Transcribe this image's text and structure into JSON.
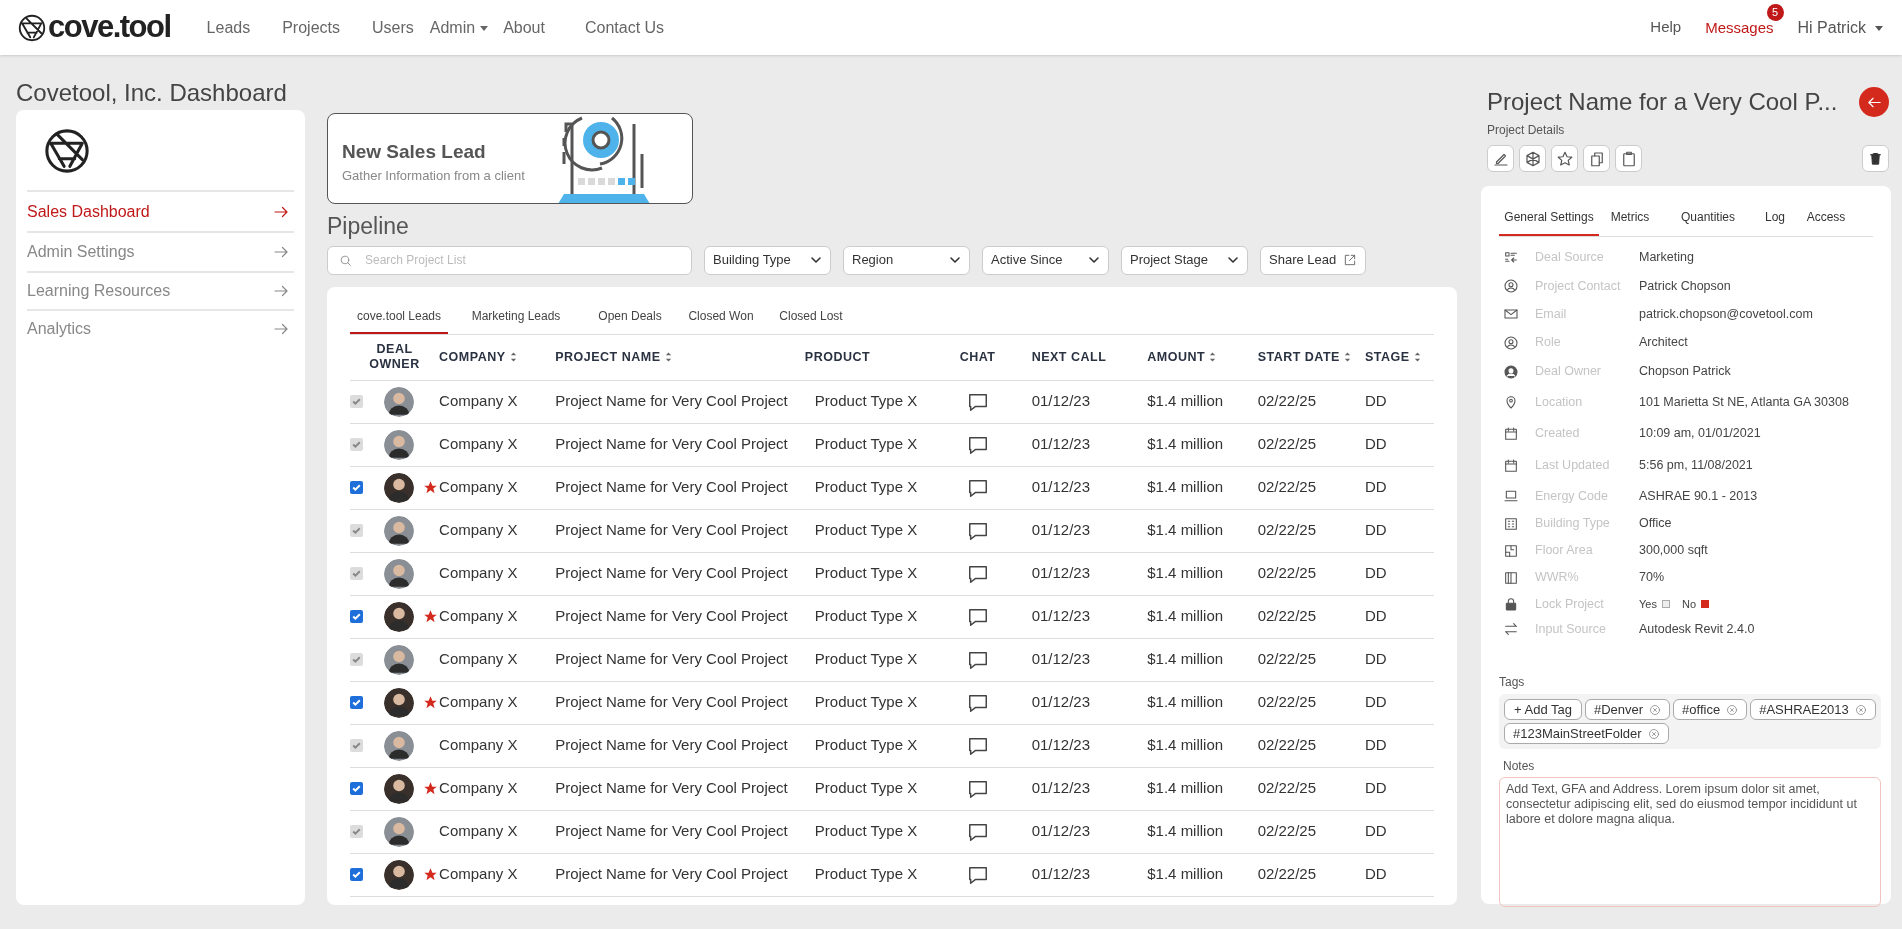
{
  "nav": {
    "logo": "cove.tool",
    "links": [
      {
        "label": "Leads",
        "dropdown": false
      },
      {
        "label": "Projects",
        "dropdown": false
      },
      {
        "label": "Users",
        "dropdown": false
      },
      {
        "label": "Admin",
        "dropdown": true
      },
      {
        "label": "About",
        "dropdown": false
      },
      {
        "label": "Contact Us",
        "dropdown": false
      }
    ],
    "right": {
      "help": "Help",
      "messages": "Messages",
      "badge": "5",
      "user": "Hi Patrick"
    }
  },
  "page_title": "Covetool, Inc. Dashboard",
  "sidebar": {
    "items": [
      {
        "label": "Sales Dashboard",
        "selected": true
      },
      {
        "label": "Admin Settings",
        "selected": false
      },
      {
        "label": "Learning Resources",
        "selected": false
      },
      {
        "label": "Analytics",
        "selected": false
      }
    ]
  },
  "new_lead": {
    "title": "New Sales Lead",
    "subtitle": "Gather Information from a client"
  },
  "pipeline": {
    "title": "Pipeline",
    "search": {
      "placeholder": "Search Project List"
    },
    "filters": [
      "Building Type",
      "Region",
      "Active Since",
      "Project Stage"
    ],
    "share": "Share Lead",
    "tabs": [
      {
        "label": "cove.tool Leads",
        "selected": true
      },
      {
        "label": "Marketing Leads",
        "selected": false
      },
      {
        "label": "Open Deals",
        "selected": false
      },
      {
        "label": "Closed Won",
        "selected": false
      },
      {
        "label": "Closed Lost",
        "selected": false
      }
    ],
    "columns": [
      {
        "label": "DEAL OWNER",
        "sortable": false
      },
      {
        "label": "COMPANY",
        "sortable": true
      },
      {
        "label": "PROJECT NAME",
        "sortable": true
      },
      {
        "label": "PRODUCT",
        "sortable": false
      },
      {
        "label": "CHAT",
        "sortable": false
      },
      {
        "label": "NEXT CALL",
        "sortable": false
      },
      {
        "label": "AMOUNT",
        "sortable": true
      },
      {
        "label": "START DATE",
        "sortable": true
      },
      {
        "label": "STAGE",
        "sortable": true
      }
    ],
    "rows": [
      {
        "checked": true,
        "disabled": true,
        "starred": false,
        "company": "Company X",
        "project": "Project Name for Very Cool Project",
        "product": "Product Type X",
        "next_call": "01/12/23",
        "amount": "$1.4 million",
        "start_date": "02/22/25",
        "stage": "DD"
      },
      {
        "checked": true,
        "disabled": true,
        "starred": false,
        "company": "Company X",
        "project": "Project Name for Very Cool Project",
        "product": "Product Type X",
        "next_call": "01/12/23",
        "amount": "$1.4 million",
        "start_date": "02/22/25",
        "stage": "DD"
      },
      {
        "checked": true,
        "disabled": false,
        "starred": true,
        "company": "Company X",
        "project": "Project Name for Very Cool Project",
        "product": "Product Type X",
        "next_call": "01/12/23",
        "amount": "$1.4 million",
        "start_date": "02/22/25",
        "stage": "DD"
      },
      {
        "checked": true,
        "disabled": true,
        "starred": false,
        "company": "Company X",
        "project": "Project Name for Very Cool Project",
        "product": "Product Type X",
        "next_call": "01/12/23",
        "amount": "$1.4 million",
        "start_date": "02/22/25",
        "stage": "DD"
      },
      {
        "checked": true,
        "disabled": true,
        "starred": false,
        "company": "Company X",
        "project": "Project Name for Very Cool Project",
        "product": "Product Type X",
        "next_call": "01/12/23",
        "amount": "$1.4 million",
        "start_date": "02/22/25",
        "stage": "DD"
      },
      {
        "checked": true,
        "disabled": false,
        "starred": true,
        "company": "Company X",
        "project": "Project Name for Very Cool Project",
        "product": "Product Type X",
        "next_call": "01/12/23",
        "amount": "$1.4 million",
        "start_date": "02/22/25",
        "stage": "DD"
      },
      {
        "checked": true,
        "disabled": true,
        "starred": false,
        "company": "Company X",
        "project": "Project Name for Very Cool Project",
        "product": "Product Type X",
        "next_call": "01/12/23",
        "amount": "$1.4 million",
        "start_date": "02/22/25",
        "stage": "DD"
      },
      {
        "checked": true,
        "disabled": false,
        "starred": true,
        "company": "Company X",
        "project": "Project Name for Very Cool Project",
        "product": "Product Type X",
        "next_call": "01/12/23",
        "amount": "$1.4 million",
        "start_date": "02/22/25",
        "stage": "DD"
      },
      {
        "checked": true,
        "disabled": true,
        "starred": false,
        "company": "Company X",
        "project": "Project Name for Very Cool Project",
        "product": "Product Type X",
        "next_call": "01/12/23",
        "amount": "$1.4 million",
        "start_date": "02/22/25",
        "stage": "DD"
      },
      {
        "checked": true,
        "disabled": false,
        "starred": true,
        "company": "Company X",
        "project": "Project Name for Very Cool Project",
        "product": "Product Type X",
        "next_call": "01/12/23",
        "amount": "$1.4 million",
        "start_date": "02/22/25",
        "stage": "DD"
      },
      {
        "checked": true,
        "disabled": true,
        "starred": false,
        "company": "Company X",
        "project": "Project Name for Very Cool Project",
        "product": "Product Type X",
        "next_call": "01/12/23",
        "amount": "$1.4 million",
        "start_date": "02/22/25",
        "stage": "DD"
      },
      {
        "checked": true,
        "disabled": false,
        "starred": true,
        "company": "Company X",
        "project": "Project Name for Very Cool Project",
        "product": "Product Type X",
        "next_call": "01/12/23",
        "amount": "$1.4 million",
        "start_date": "02/22/25",
        "stage": "DD"
      }
    ]
  },
  "details": {
    "title": "Project Name for a Very Cool P...",
    "subtitle": "Project Details",
    "tabs": [
      {
        "label": "General Settings",
        "selected": true
      },
      {
        "label": "Metrics",
        "selected": false
      },
      {
        "label": "Quantities",
        "selected": false
      },
      {
        "label": "Log",
        "selected": false
      },
      {
        "label": "Access",
        "selected": false
      }
    ],
    "fields": [
      {
        "kind": "source",
        "label": "Deal Source",
        "value": "Marketing"
      },
      {
        "kind": "person",
        "label": "Project Contact",
        "value": "Patrick Chopson"
      },
      {
        "kind": "email",
        "label": "Email",
        "value": "patrick.chopson@covetool.com"
      },
      {
        "kind": "person",
        "label": "Role",
        "value": "Architect"
      },
      {
        "kind": "owner",
        "label": "Deal Owner",
        "value": "Chopson Patrick"
      },
      {
        "kind": "location",
        "label": "Location",
        "value": "101 Marietta St NE, Atlanta GA 30308"
      },
      {
        "kind": "calendar",
        "label": "Created",
        "value": "10:09 am, 01/01/2021"
      },
      {
        "kind": "calendar",
        "label": "Last Updated",
        "value": "5:56 pm, 11/08/2021"
      },
      {
        "kind": "laptop",
        "label": "Energy Code",
        "value": "ASHRAE 90.1 - 2013"
      },
      {
        "kind": "building",
        "label": "Building Type",
        "value": "Office"
      },
      {
        "kind": "area",
        "label": "Floor Area",
        "value": "300,000 sqft"
      },
      {
        "kind": "window",
        "label": "WWR%",
        "value": "70%"
      },
      {
        "kind": "lock",
        "label": "Lock Project",
        "options": [
          {
            "label": "Yes",
            "selected": false
          },
          {
            "label": "No",
            "selected": true
          }
        ]
      },
      {
        "kind": "swap",
        "label": "Input Source",
        "value": "Autodesk Revit 2.4.0"
      }
    ],
    "tags_label": "Tags",
    "tags": [
      {
        "kind": "add",
        "label": "+ Add Tag"
      },
      {
        "kind": "tag",
        "label": "#Denver"
      },
      {
        "kind": "tag",
        "label": "#office"
      },
      {
        "kind": "tag",
        "label": "#ASHRAE2013"
      },
      {
        "kind": "tag",
        "label": "#123MainStreetFolder"
      }
    ],
    "notes_label": "Notes",
    "notes": "Add Text, GFA and Address. Lorem ipsum dolor sit amet, consectetur adipiscing elit, sed do eiusmod tempor incididunt ut labore et dolore magna aliqua."
  }
}
